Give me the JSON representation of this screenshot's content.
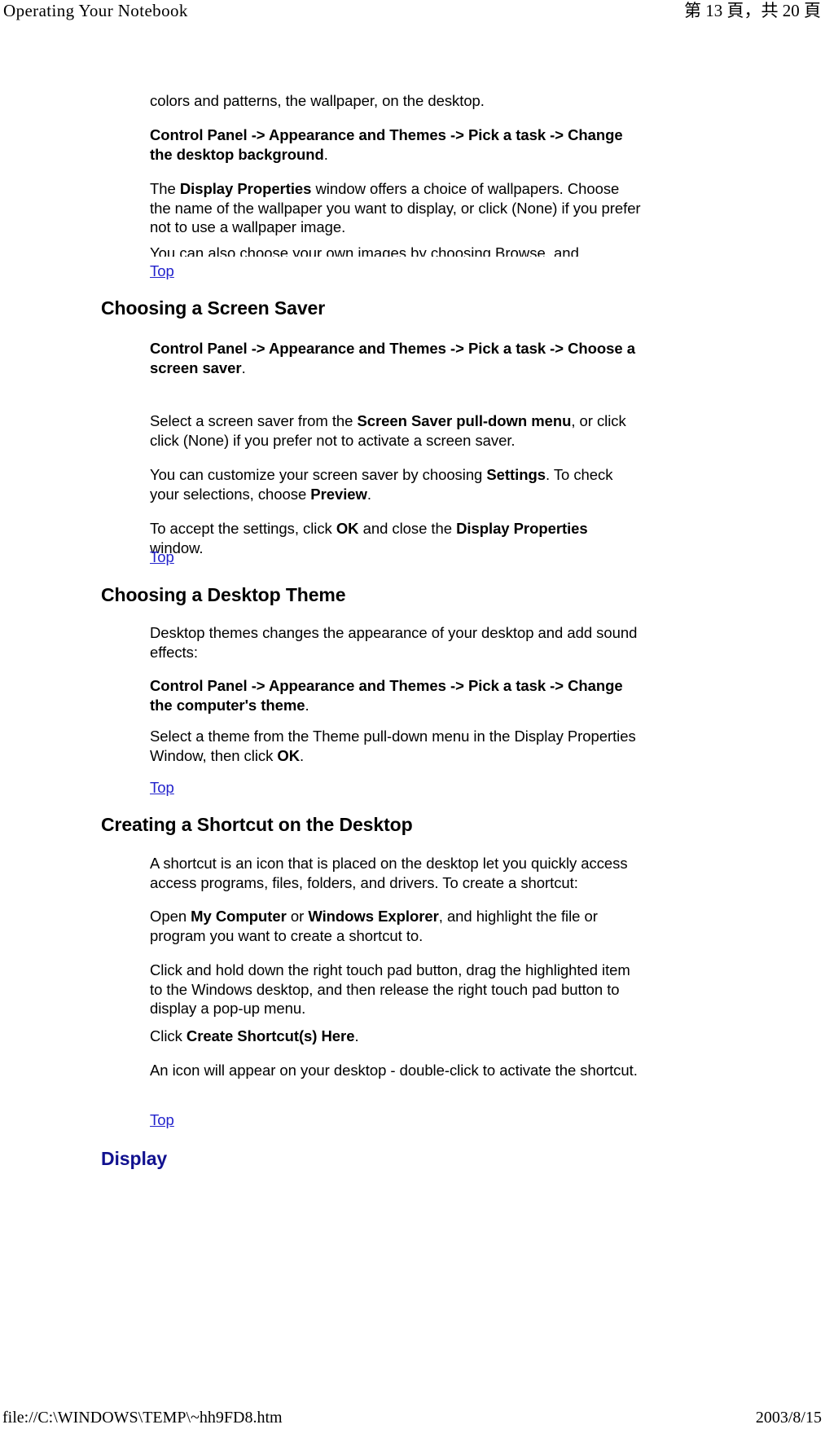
{
  "header": {
    "left_title": "Operating Your Notebook",
    "right_page_indicator": "第 13 頁，共 20 頁"
  },
  "footer": {
    "file_path": "file://C:\\WINDOWS\\TEMP\\~hh9FD8.htm",
    "date": "2003/8/15"
  },
  "content": {
    "para_wallpaper_continued": "colors and patterns, the wallpaper, on the desktop.",
    "path_change_desktop_background_bold": "Control Panel -> Appearance and Themes -> Pick a task -> Change the desktop background",
    "path_change_desktop_background_period": ".",
    "display_properties_p1_a": "The ",
    "display_properties_p1_b": "Display Properties",
    "display_properties_p1_c": " window offers a choice of wallpapers. Choose the name of the wallpaper you want to display, or click (None) if you prefer not to use a wallpaper image.",
    "clipped_browse_line": "You can also choose your own images by choosing Browse, and",
    "top_link_1": "Top",
    "heading_screen_saver": "Choosing a Screen Saver",
    "path_choose_screen_saver_bold": "Control Panel -> Appearance and Themes -> Pick a task -> Choose a screen saver",
    "path_choose_screen_saver_period": ".",
    "screen_saver_select_a": "Select a screen saver from the ",
    "screen_saver_select_b": "Screen Saver pull-down menu",
    "screen_saver_select_c": ", or click click (None) if you prefer not to activate a screen saver.",
    "screen_saver_customize_a": "You can customize your screen saver by choosing ",
    "screen_saver_customize_b": "Settings",
    "screen_saver_customize_c": ". To check your selections, choose ",
    "screen_saver_customize_d": "Preview",
    "screen_saver_customize_e": ".",
    "screen_saver_accept_a": "To accept the settings, click ",
    "screen_saver_accept_b": "OK",
    "screen_saver_accept_c": " and close the ",
    "screen_saver_accept_d": "Display Properties",
    "screen_saver_accept_e": " window.",
    "top_link_2": "Top",
    "heading_desktop_theme": "Choosing a Desktop Theme",
    "desktop_theme_intro": "Desktop themes changes the appearance of your desktop and add sound effects:",
    "path_change_computer_theme_bold": "Control Panel -> Appearance and Themes -> Pick a task -> Change the computer's theme",
    "path_change_computer_theme_period": ".",
    "desktop_theme_select_a": "Select a theme from the Theme pull-down menu in the Display Properties Window, then click ",
    "desktop_theme_select_b": "OK",
    "desktop_theme_select_c": ".",
    "top_link_3": "Top",
    "heading_create_shortcut": "Creating a Shortcut on the Desktop",
    "shortcut_intro": "A shortcut is an icon that is placed on the desktop let you quickly access access programs, files, folders, and drivers. To create a shortcut:",
    "shortcut_open_a": "Open ",
    "shortcut_open_b": "My Computer",
    "shortcut_open_c": " or ",
    "shortcut_open_d": "Windows Explorer",
    "shortcut_open_e": ", and highlight the file or program you want to create a shortcut to.",
    "shortcut_drag": "Click and hold down the right touch pad button, drag the highlighted item to the Windows desktop, and then release the right touch pad button to display a pop-up menu.",
    "shortcut_click_a": "Click ",
    "shortcut_click_b": "Create Shortcut(s) Here",
    "shortcut_click_c": ".",
    "shortcut_icon_appear": "An icon will appear on your desktop - double-click to activate the shortcut.",
    "top_link_4": "Top",
    "heading_display": "Display"
  },
  "colors": {
    "link": "#2222cc",
    "heading_blue": "#11118f",
    "text": "#000000",
    "background": "#ffffff"
  }
}
